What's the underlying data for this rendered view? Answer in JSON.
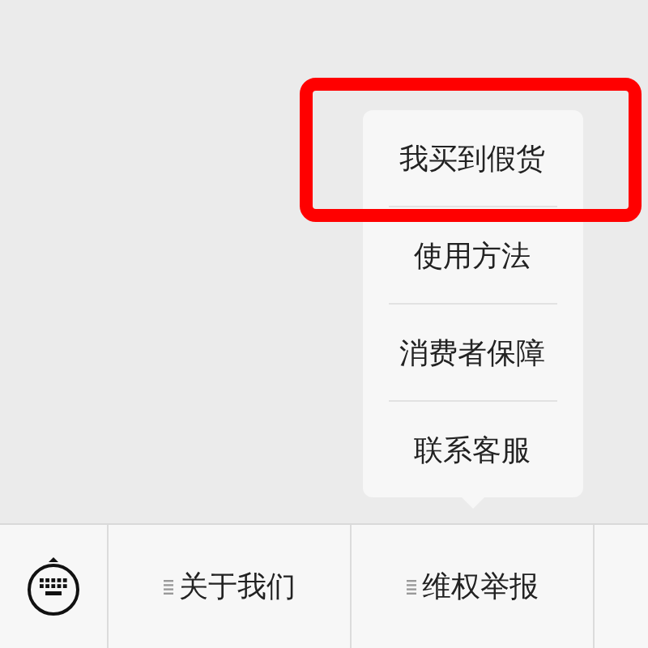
{
  "menu_bar": {
    "items": [
      {
        "label": "关于我们"
      },
      {
        "label": "维权举报",
        "submenu": [
          {
            "label": "我买到假货",
            "highlighted": true
          },
          {
            "label": "使用方法",
            "highlighted": false
          },
          {
            "label": "消费者保障",
            "highlighted": false
          },
          {
            "label": "联系客服",
            "highlighted": false
          }
        ]
      }
    ]
  }
}
